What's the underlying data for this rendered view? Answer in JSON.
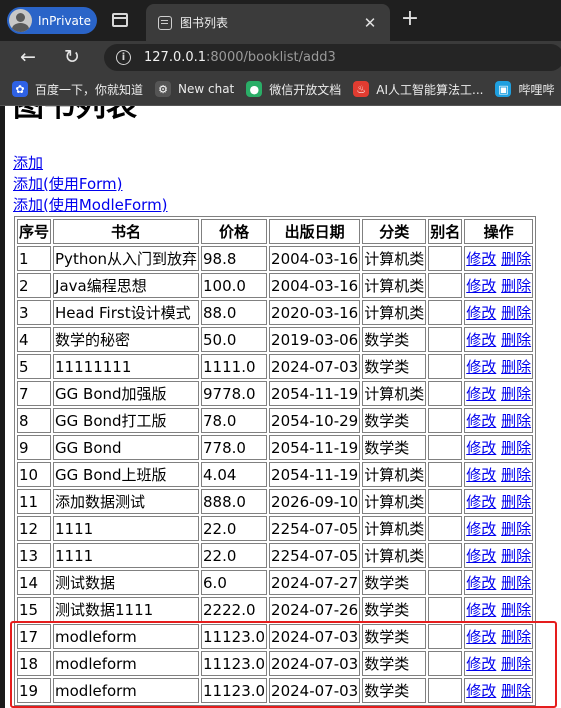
{
  "browser": {
    "profile_label": "InPrivate",
    "tab_title": "图书列表",
    "tab_close": "✕",
    "new_tab": "+",
    "back": "←",
    "reload": "↻",
    "url_host": "127.0.0.1",
    "url_rest": ":8000/booklist/add3"
  },
  "bookmarks": [
    {
      "label": "百度一下，你就知道",
      "icon": "baidu-paw-icon",
      "color": "#2f62e5",
      "glyph": "✿"
    },
    {
      "label": "New chat",
      "icon": "openai-icon",
      "color": "#555555",
      "glyph": "⚙"
    },
    {
      "label": "微信开放文档",
      "icon": "wechat-icon",
      "color": "#2aae67",
      "glyph": "●"
    },
    {
      "label": "AI人工智能算法工...",
      "icon": "flame-icon",
      "color": "#e03c31",
      "glyph": "♨"
    },
    {
      "label": "哔哩哔",
      "icon": "bilibili-icon",
      "color": "#1fa0e0",
      "glyph": "▣"
    }
  ],
  "page": {
    "heading": "图书列表",
    "links": [
      "添加",
      "添加(使用Form)",
      "添加(使用ModleForm)"
    ],
    "headers": [
      "序号",
      "书名",
      "价格",
      "出版日期",
      "分类",
      "别名",
      "操作"
    ],
    "edit_label": "修改",
    "delete_label": "删除",
    "rows": [
      [
        "1",
        "Python从入门到放弃",
        "98.8",
        "2004-03-16",
        "计算机类",
        ""
      ],
      [
        "2",
        "Java编程思想",
        "100.0",
        "2004-03-16",
        "计算机类",
        ""
      ],
      [
        "3",
        "Head First设计模式",
        "88.0",
        "2020-03-16",
        "计算机类",
        ""
      ],
      [
        "4",
        "数学的秘密",
        "50.0",
        "2019-03-06",
        "数学类",
        ""
      ],
      [
        "5",
        "11111111",
        "1111.0",
        "2024-07-03",
        "数学类",
        ""
      ],
      [
        "7",
        "GG Bond加强版",
        "9778.0",
        "2054-11-19",
        "计算机类",
        ""
      ],
      [
        "8",
        "GG Bond打工版",
        "78.0",
        "2054-10-29",
        "数学类",
        ""
      ],
      [
        "9",
        "GG Bond",
        "778.0",
        "2054-11-19",
        "数学类",
        ""
      ],
      [
        "10",
        "GG Bond上班版",
        "4.04",
        "2054-11-19",
        "计算机类",
        ""
      ],
      [
        "11",
        "添加数据测试",
        "888.0",
        "2026-09-10",
        "计算机类",
        ""
      ],
      [
        "12",
        "1111",
        "22.0",
        "2254-07-05",
        "计算机类",
        ""
      ],
      [
        "13",
        "1111",
        "22.0",
        "2254-07-05",
        "计算机类",
        ""
      ],
      [
        "14",
        "测试数据",
        "6.0",
        "2024-07-27",
        "数学类",
        ""
      ],
      [
        "15",
        "测试数据1111",
        "2222.0",
        "2024-07-26",
        "数学类",
        ""
      ],
      [
        "17",
        "modleform",
        "11123.0",
        "2024-07-03",
        "数学类",
        ""
      ],
      [
        "18",
        "modleform",
        "11123.0",
        "2024-07-03",
        "数学类",
        ""
      ],
      [
        "19",
        "modleform",
        "11123.0",
        "2024-07-03",
        "数学类",
        ""
      ]
    ],
    "highlight_color": "#e51d1d"
  }
}
